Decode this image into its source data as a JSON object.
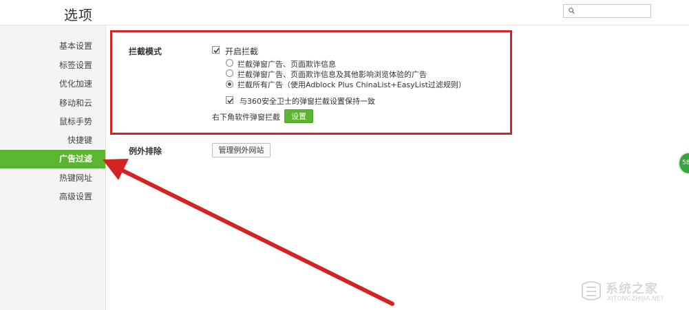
{
  "header": {
    "title": "选项",
    "search": {
      "value": "",
      "placeholder": ""
    }
  },
  "sidebar": {
    "items": [
      {
        "label": "基本设置",
        "active": false
      },
      {
        "label": "标签设置",
        "active": false
      },
      {
        "label": "优化加速",
        "active": false
      },
      {
        "label": "移动和云",
        "active": false
      },
      {
        "label": "鼠标手势",
        "active": false
      },
      {
        "label": "快捷键",
        "active": false
      },
      {
        "label": "广告过滤",
        "active": true
      },
      {
        "label": "热键网址",
        "active": false
      },
      {
        "label": "高级设置",
        "active": false
      }
    ]
  },
  "block_mode": {
    "label": "拦截模式",
    "enable": {
      "label": "开启拦截",
      "checked": true
    },
    "options": [
      {
        "label": "拦截弹窗广告、页面欺诈信息",
        "selected": false
      },
      {
        "label": "拦截弹窗广告、页面欺诈信息及其他影响浏览体验的广告",
        "selected": false
      },
      {
        "label": "拦截所有广告（使用Adblock Plus ChinaList+EasyList过滤规则）",
        "selected": true
      }
    ],
    "sync_360": {
      "label": "与360安全卫士的弹窗拦截设置保持一致",
      "checked": true
    },
    "popup_label": "右下角软件弹窗拦截",
    "settings_button": "设置"
  },
  "exceptions": {
    "label": "例外排除",
    "manage_button": "管理例外网站"
  },
  "floating_badge": {
    "text": "58"
  },
  "watermark": {
    "text": "系统之家",
    "url": "XITONGZHIJIA.NET"
  },
  "colors": {
    "accent_green": "#5cb531",
    "highlight_red": "#d42323"
  }
}
